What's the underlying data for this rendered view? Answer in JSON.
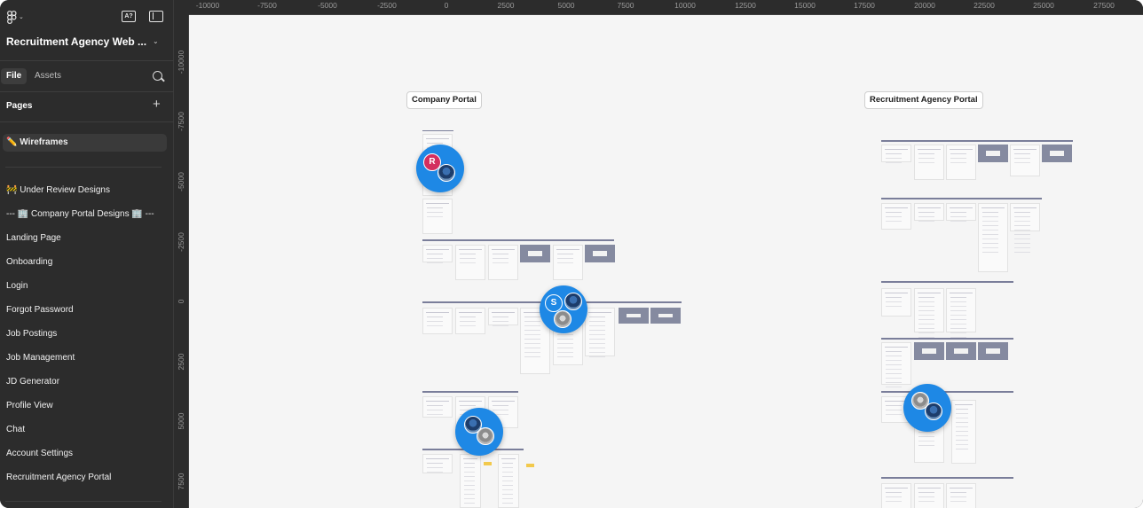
{
  "app": {
    "file_title": "Recruitment Agency Web ...",
    "toolbar": {
      "ai_button": "A?"
    }
  },
  "sidebar": {
    "tabs": [
      {
        "label": "File",
        "active": true
      },
      {
        "label": "Assets",
        "active": false
      }
    ],
    "pages_header": "Pages",
    "pages": [
      {
        "label": "✏️ Wireframes",
        "selected": true
      },
      {
        "label": "🚧 Under Review Designs",
        "selected": false
      },
      {
        "label": "--- 🏢 Company Portal Designs 🏢 ---",
        "selected": false
      },
      {
        "label": "Landing Page",
        "selected": false
      },
      {
        "label": "Onboarding",
        "selected": false
      },
      {
        "label": "Login",
        "selected": false
      },
      {
        "label": "Forgot Password",
        "selected": false
      },
      {
        "label": "Job Postings",
        "selected": false
      },
      {
        "label": "Job Management",
        "selected": false
      },
      {
        "label": "JD Generator",
        "selected": false
      },
      {
        "label": "Profile View",
        "selected": false
      },
      {
        "label": "Chat",
        "selected": false
      },
      {
        "label": "Account Settings",
        "selected": false
      },
      {
        "label": "Recruitment Agency Portal",
        "selected": false
      }
    ]
  },
  "rulers": {
    "horizontal": [
      "-10000",
      "-7500",
      "-5000",
      "-2500",
      "0",
      "2500",
      "5000",
      "7500",
      "10000",
      "12500",
      "15000",
      "17500",
      "20000",
      "22500",
      "25000",
      "27500"
    ],
    "vertical": [
      "-10000",
      "-7500",
      "-5000",
      "-2500",
      "0",
      "2500",
      "5000",
      "7500"
    ]
  },
  "canvas": {
    "sections": [
      {
        "label": "Company Portal"
      },
      {
        "label": "Recruitment Agency Portal"
      }
    ],
    "collaborators": [
      {
        "initial": "R",
        "color": "#d32f5f"
      },
      {
        "initial": "S",
        "color": "#1e88e5"
      }
    ],
    "background": "#f5f5f5"
  },
  "colors": {
    "sidebar_bg": "#2c2c2c",
    "cursor_blue": "#1e88e5",
    "row_line": "#7a7e9a",
    "dark_frame": "#858aa0"
  }
}
